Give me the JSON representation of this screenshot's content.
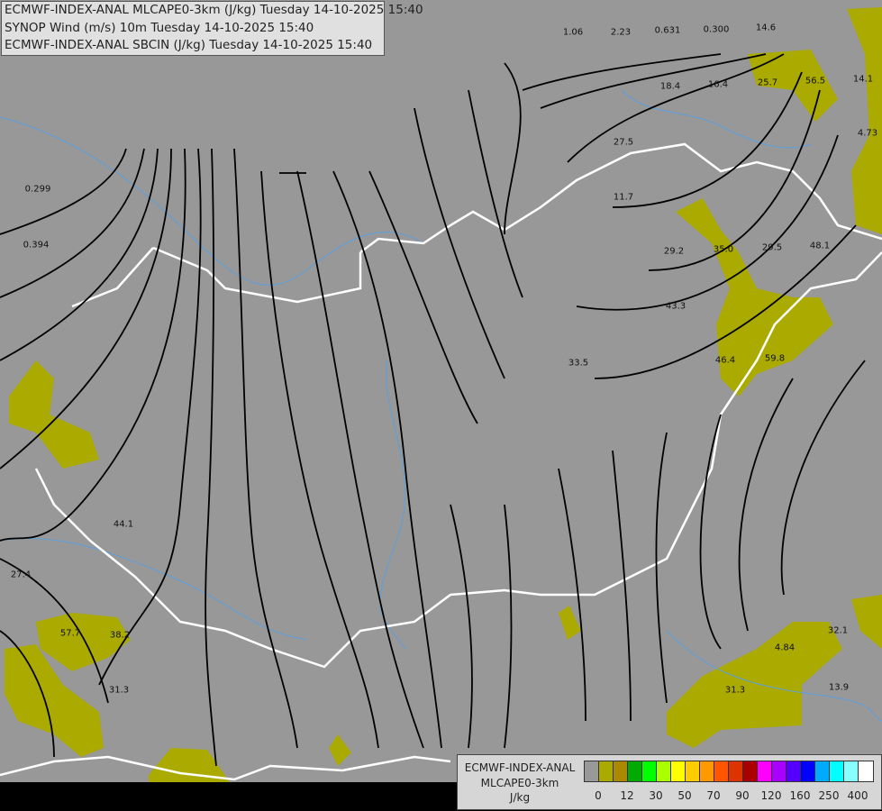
{
  "header": {
    "lines": [
      "ECMWF-INDEX-ANAL MLCAPE0-3km (J/kg) Tuesday 14-10-2025 15:40",
      "SYNOP Wind (m/s) 10m Tuesday 14-10-2025 15:40",
      "ECMWF-INDEX-ANAL SBCIN (J/kg) Tuesday 14-10-2025 15:40"
    ]
  },
  "legend": {
    "title": "ECMWF-INDEX-ANAL",
    "parameter": "MLCAPE0-3km",
    "unit": "J/kg",
    "colors": [
      "#999999",
      "#aaaa00",
      "#aa8800",
      "#00aa00",
      "#00ff00",
      "#aaff00",
      "#ffff00",
      "#ffcc00",
      "#ff9900",
      "#ff5500",
      "#dd3300",
      "#aa0000",
      "#ff00ff",
      "#aa00ff",
      "#5500ff",
      "#0000ff",
      "#00aaff",
      "#00ffff",
      "#88ffff",
      "#ffffff"
    ],
    "tick_labels": [
      "0",
      "12",
      "30",
      "50",
      "70",
      "90",
      "120",
      "160",
      "250",
      "400"
    ]
  },
  "map": {
    "background_color": "#989898",
    "cape_fill_color": "#aaaa00",
    "border_color": "#ffffff",
    "river_color": "#5aa0e0",
    "cin_values": [
      "1.06",
      "2.23",
      "0.631",
      "0.300",
      "14.6",
      "0.299",
      "0.394",
      "18.4",
      "16.4",
      "25.7",
      "56.5",
      "14.1",
      "4.73",
      "27.5",
      "11.7",
      "29.2",
      "35.0",
      "29.5",
      "48.1",
      "43.3",
      "33.5",
      "46.4",
      "59.8",
      "44.1",
      "27.4",
      "57.7",
      "38.2",
      "31.3",
      "4.84",
      "32.1",
      "31.3",
      "13.9"
    ]
  }
}
